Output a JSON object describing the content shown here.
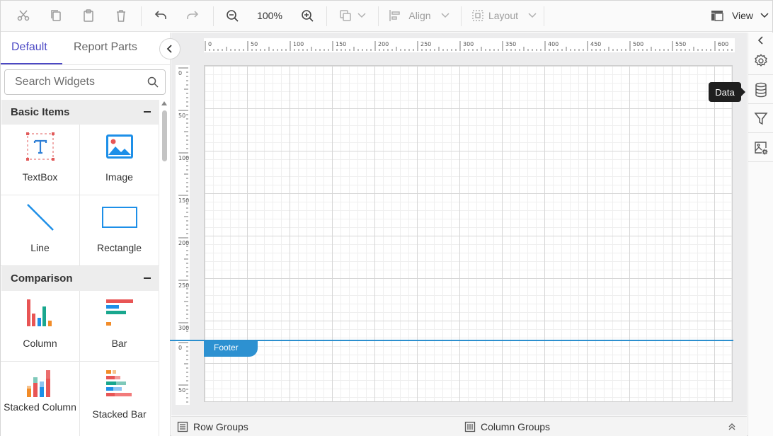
{
  "toolbar": {
    "zoom": "100%",
    "align_label": "Align",
    "layout_label": "Layout",
    "view_label": "View"
  },
  "left_panel": {
    "tabs": [
      {
        "label": "Default",
        "active": true
      },
      {
        "label": "Report Parts",
        "active": false
      }
    ],
    "search_placeholder": "Search Widgets",
    "sections": [
      {
        "title": "Basic Items",
        "items": [
          {
            "label": "TextBox",
            "icon": "textbox-icon"
          },
          {
            "label": "Image",
            "icon": "image-icon"
          },
          {
            "label": "Line",
            "icon": "line-icon"
          },
          {
            "label": "Rectangle",
            "icon": "rectangle-icon"
          }
        ]
      },
      {
        "title": "Comparison",
        "items": [
          {
            "label": "Column",
            "icon": "column-chart-icon"
          },
          {
            "label": "Bar",
            "icon": "bar-chart-icon"
          },
          {
            "label": "Stacked Column",
            "icon": "stacked-column-chart-icon"
          },
          {
            "label": "Stacked Bar",
            "icon": "stacked-bar-chart-icon"
          }
        ]
      }
    ]
  },
  "rulers": {
    "top": [
      "0",
      "50",
      "100",
      "150",
      "200",
      "250",
      "300",
      "350",
      "400",
      "450",
      "500",
      "550",
      "600"
    ],
    "left_body": [
      "0",
      "50",
      "100",
      "150",
      "200",
      "250",
      "300"
    ],
    "left_footer": [
      "0",
      "50"
    ]
  },
  "canvas": {
    "footer_label": "Footer"
  },
  "bottom_bar": {
    "row_groups": "Row Groups",
    "column_groups": "Column Groups"
  },
  "right_panel": {
    "tooltip": "Data",
    "buttons": [
      "collapse-icon",
      "gear-icon",
      "database-icon",
      "filter-icon",
      "image-settings-icon"
    ]
  },
  "colors": {
    "accent": "#4b48c4",
    "footer_blue": "#2d91d1"
  }
}
